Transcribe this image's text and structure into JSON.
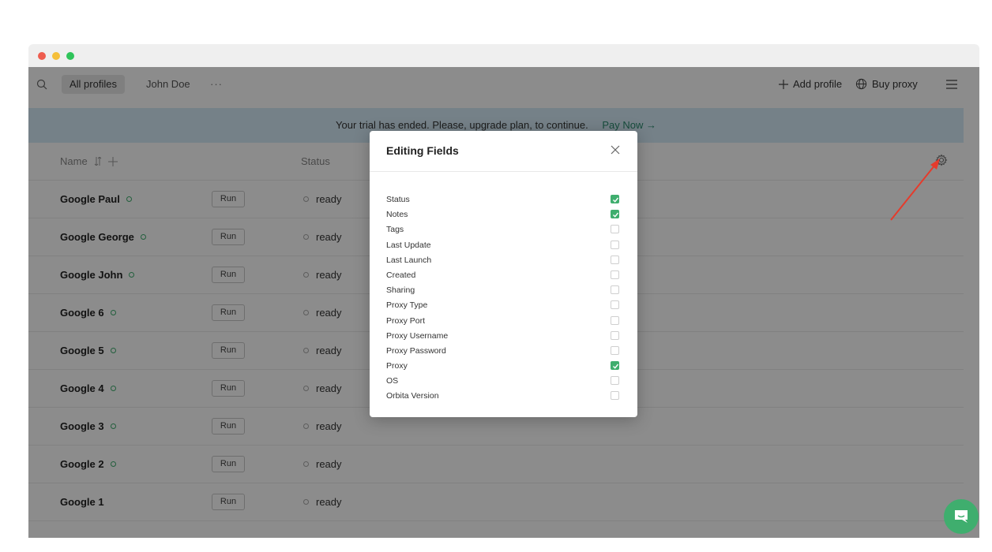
{
  "toolbar": {
    "tabs": [
      "All profiles",
      "John Doe",
      "···"
    ],
    "add_profile": "Add profile",
    "buy_proxy": "Buy proxy"
  },
  "banner": {
    "message": "Your trial has ended. Please, upgrade plan, to continue.",
    "pay_link": "Pay Now"
  },
  "table": {
    "headers": {
      "name": "Name",
      "status": "Status"
    },
    "rows": [
      {
        "name": "Google Paul",
        "run": "Run",
        "status": "ready"
      },
      {
        "name": "Google George",
        "run": "Run",
        "status": "ready"
      },
      {
        "name": "Google John",
        "run": "Run",
        "status": "ready"
      },
      {
        "name": "Google 6",
        "run": "Run",
        "status": "ready"
      },
      {
        "name": "Google 5",
        "run": "Run",
        "status": "ready"
      },
      {
        "name": "Google 4",
        "run": "Run",
        "status": "ready"
      },
      {
        "name": "Google 3",
        "run": "Run",
        "status": "ready"
      },
      {
        "name": "Google 2",
        "run": "Run",
        "status": "ready"
      },
      {
        "name": "Google 1",
        "run": "Run",
        "status": "ready"
      }
    ]
  },
  "modal": {
    "title": "Editing Fields",
    "fields": [
      {
        "label": "Status",
        "checked": true
      },
      {
        "label": "Notes",
        "checked": true
      },
      {
        "label": "Tags",
        "checked": false
      },
      {
        "label": "Last Update",
        "checked": false
      },
      {
        "label": "Last Launch",
        "checked": false
      },
      {
        "label": "Created",
        "checked": false
      },
      {
        "label": "Sharing",
        "checked": false
      },
      {
        "label": "Proxy Type",
        "checked": false
      },
      {
        "label": "Proxy Port",
        "checked": false
      },
      {
        "label": "Proxy Username",
        "checked": false
      },
      {
        "label": "Proxy Password",
        "checked": false
      },
      {
        "label": "Proxy",
        "checked": true
      },
      {
        "label": "OS",
        "checked": false
      },
      {
        "label": "Orbita Version",
        "checked": false
      }
    ]
  },
  "colors": {
    "accent": "#3fae6e",
    "banner": "#d6ecf8",
    "arrow": "#e53b2c"
  },
  "icons": [
    "search-icon",
    "plus-icon",
    "globe-icon",
    "menu-icon",
    "sort-icon",
    "gear-icon",
    "close-icon",
    "check-icon",
    "chat-icon"
  ]
}
